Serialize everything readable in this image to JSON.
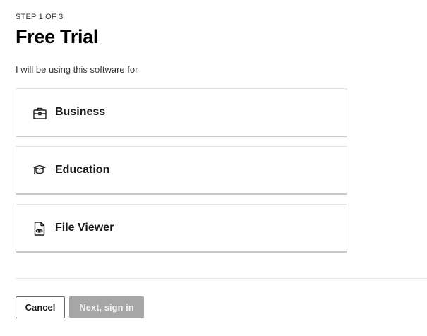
{
  "header": {
    "step": "STEP 1 OF 3",
    "title": "Free Trial",
    "subtitle": "I will be using this software for"
  },
  "options": [
    {
      "label": "Business",
      "icon": "briefcase-icon"
    },
    {
      "label": "Education",
      "icon": "graduation-cap-icon"
    },
    {
      "label": "File Viewer",
      "icon": "file-view-icon"
    }
  ],
  "footer": {
    "cancel_label": "Cancel",
    "next_label": "Next, sign in"
  },
  "colors": {
    "text": "#000000",
    "border": "#e2e2e2",
    "next_disabled": "#a6a6a6"
  }
}
